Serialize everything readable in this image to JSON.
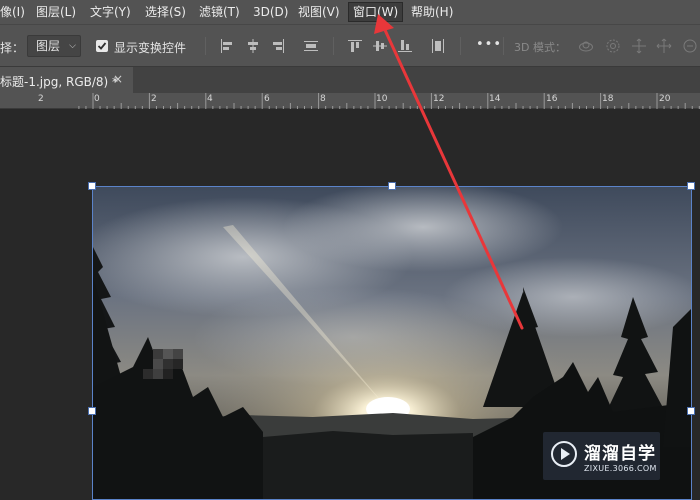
{
  "menubar": {
    "items": [
      {
        "label": "像(I)"
      },
      {
        "label": "图层(L)"
      },
      {
        "label": "文字(Y)"
      },
      {
        "label": "选择(S)"
      },
      {
        "label": "滤镜(T)"
      },
      {
        "label": "3D(D)"
      },
      {
        "label": "视图(V)"
      },
      {
        "label": "窗口(W)"
      },
      {
        "label": "帮助(H)"
      }
    ]
  },
  "options": {
    "select_label": "择：",
    "layer_dropdown": "图层",
    "show_transform_controls": "显示变换控件",
    "show_transform_checked": true,
    "more": "•••",
    "mode_3d_label": "3D 模式："
  },
  "document": {
    "tab_title": "标题-1.jpg, RGB/8) *",
    "close": "×"
  },
  "ruler": {
    "labels": [
      "2",
      "0",
      "2",
      "4",
      "6",
      "8",
      "10",
      "12",
      "14",
      "16",
      "18",
      "20"
    ]
  },
  "watermark": {
    "title": "溜溜自学",
    "url": "ZIXUE.3066.COM"
  },
  "colors": {
    "menubar": "#535353",
    "canvas": "#282828",
    "selection": "#5b83c9",
    "annotation_arrow": "#e8373a"
  }
}
